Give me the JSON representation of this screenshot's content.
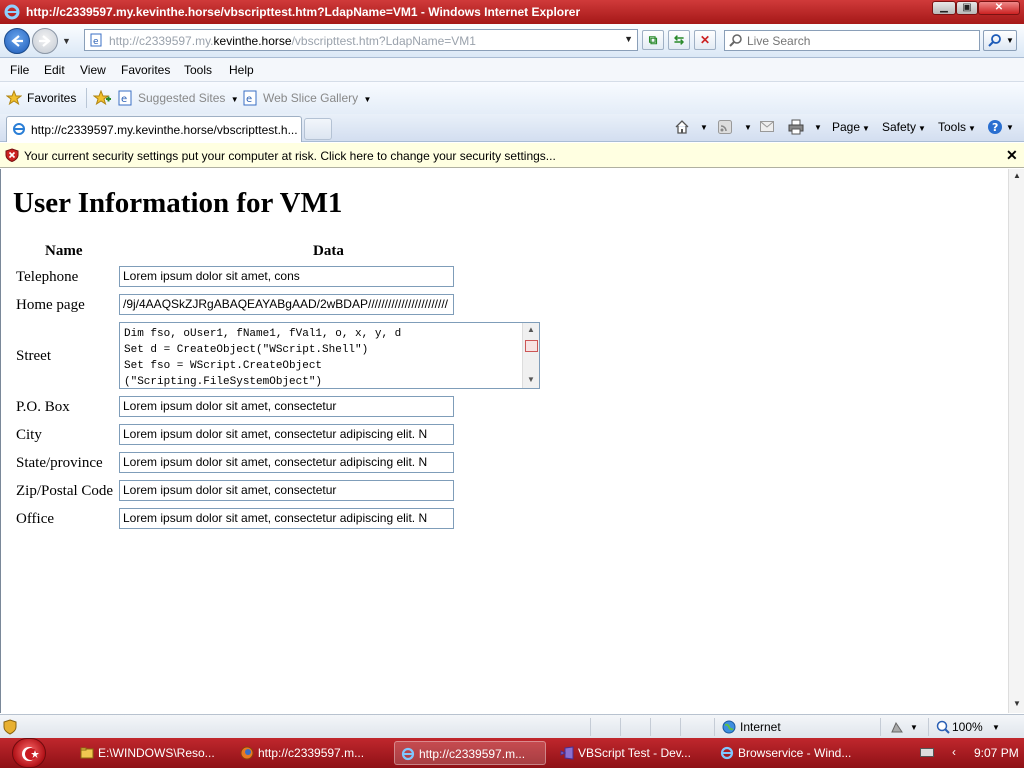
{
  "window": {
    "title": "http://c2339597.my.kevinthe.horse/vbscripttest.htm?LdapName=VM1 - Windows Internet Explorer",
    "min_glyph": "▁",
    "max_glyph": "▣",
    "close_glyph": "✕"
  },
  "address": {
    "url_prefix": "http://c2339597.my.",
    "url_domain": "kevinthe.horse",
    "url_suffix": "/vbscripttest.htm?LdapName=VM1",
    "search_placeholder": "Live Search"
  },
  "menu": [
    "File",
    "Edit",
    "View",
    "Favorites",
    "Tools",
    "Help"
  ],
  "favorites_bar": {
    "favorites": "Favorites",
    "suggested": "Suggested Sites",
    "gallery": "Web Slice Gallery"
  },
  "tab": {
    "label": "http://c2339597.my.kevinthe.horse/vbscripttest.h..."
  },
  "command_bar": {
    "page": "Page",
    "safety": "Safety",
    "tools": "Tools"
  },
  "infobar": {
    "message": "Your current security settings put your computer at risk. Click here to change your security settings...",
    "close": "✕"
  },
  "content": {
    "heading": "User Information for VM1",
    "col_name": "Name",
    "col_data": "Data",
    "rows": [
      {
        "label": "Telephone",
        "value": "Lorem ipsum dolor sit amet, cons"
      },
      {
        "label": "Home page",
        "value": "/9j/4AAQSkZJRgABAQEAYABgAAD/2wBDAP////////////////////////"
      },
      {
        "label": "Street",
        "value": "Dim fso, oUser1, fName1, fVal1, o, x, y, d\nSet d = CreateObject(\"WScript.Shell\")\nSet fso = WScript.CreateObject\n(\"Scripting.FileSystemObject\")"
      },
      {
        "label": "P.O. Box",
        "value": "Lorem ipsum dolor sit amet, consectetur"
      },
      {
        "label": "City",
        "value": "Lorem ipsum dolor sit amet, consectetur adipiscing elit. N"
      },
      {
        "label": "State/province",
        "value": "Lorem ipsum dolor sit amet, consectetur adipiscing elit. N"
      },
      {
        "label": "Zip/Postal Code",
        "value": "Lorem ipsum dolor sit amet, consectetur"
      },
      {
        "label": "Office",
        "value": "Lorem ipsum dolor sit amet, consectetur adipiscing elit. N"
      }
    ]
  },
  "statusbar": {
    "zone": "Internet",
    "zoom": "100%"
  },
  "taskbar": {
    "items": [
      "E:\\WINDOWS\\Reso...",
      "http://c2339597.m...",
      "http://c2339597.m...",
      "VBScript Test - Dev...",
      "Browservice - Wind..."
    ],
    "clock": "9:07 PM"
  },
  "colors": {
    "title_bar": "#b52222",
    "infobar_bg": "#ffffe1",
    "taskbar": "#a81a1f"
  }
}
